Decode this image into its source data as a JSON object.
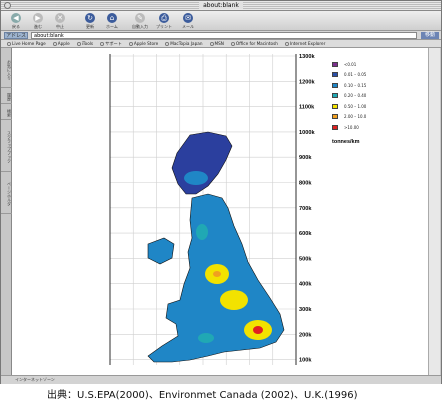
{
  "window": {
    "title": "about:blank"
  },
  "toolbar": {
    "buttons": [
      "戻る",
      "進む",
      "中止",
      "更新",
      "ホーム",
      "自動入力",
      "プリント",
      "メール"
    ]
  },
  "address": {
    "label": "アドレス",
    "value": "about:blank",
    "go": "移動"
  },
  "favorites": [
    "Live Home Page",
    "Apple",
    "iTools",
    "サポート",
    "Apple Store",
    "MacTopia Japan",
    "MSN",
    "Office for Macintosh",
    "Internet Explorer"
  ],
  "side_tabs": [
    "お気に入り",
    "履歴",
    "検索",
    "スクラップブック",
    "ページホルダ"
  ],
  "status": "インターネットゾーン",
  "map": {
    "y_axis_labels": [
      "1300k",
      "1200k",
      "1100k",
      "1000k",
      "900k",
      "800k",
      "700k",
      "600k",
      "500k",
      "400k",
      "300k",
      "200k",
      "100k"
    ],
    "legend": [
      {
        "label": "<0.01",
        "color": "#7b2f8e"
      },
      {
        "label": "0.01 – 0.05",
        "color": "#2b4fa8"
      },
      {
        "label": "0.10 – 0.15",
        "color": "#1f86c6"
      },
      {
        "label": "0.20 – 0.40",
        "color": "#20a8b4"
      },
      {
        "label": "0.50 – 1.00",
        "color": "#f2e200"
      },
      {
        "label": "2.00 – 10.0",
        "color": "#f0a020"
      },
      {
        "label": ">10.00",
        "color": "#e02020"
      }
    ],
    "unit": "tonnes/km"
  },
  "caption": "出典：U.S.EPA(2000)、Environmet  Canada (2002)、U.K.(1996)"
}
